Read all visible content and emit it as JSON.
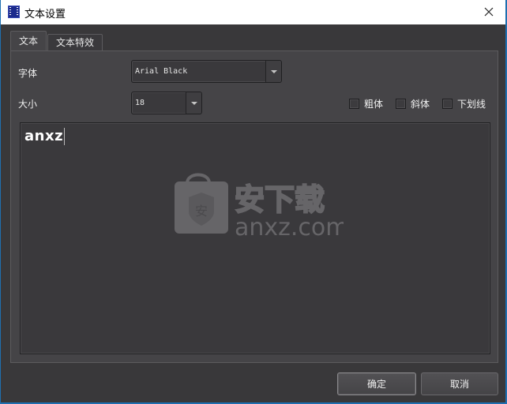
{
  "window": {
    "title": "文本设置",
    "app_icon": "film-strip-icon",
    "close_icon": "close-icon"
  },
  "tabs": [
    {
      "label": "文本",
      "active": true
    },
    {
      "label": "文本特效",
      "active": false
    }
  ],
  "form": {
    "font_label": "字体",
    "font_value": "Arial Black",
    "size_label": "大小",
    "size_value": "18",
    "bold_label": "粗体",
    "bold_checked": false,
    "italic_label": "斜体",
    "italic_checked": false,
    "underline_label": "下划线",
    "underline_checked": false
  },
  "editor": {
    "text": "anxz"
  },
  "watermark": {
    "badge_char": "安",
    "brand_cn": "安下载",
    "brand_url": "anxz.com"
  },
  "buttons": {
    "ok": "确定",
    "cancel": "取消"
  }
}
